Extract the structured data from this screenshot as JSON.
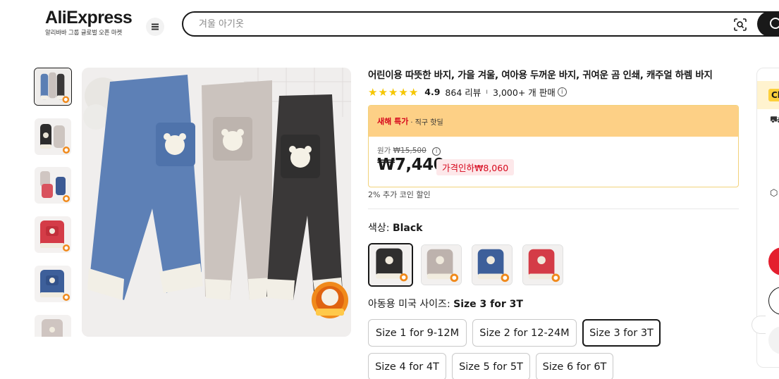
{
  "header": {
    "logo_text": "AliExpress",
    "logo_tagline": "알리바바 그룹 글로벌 오픈 마켓",
    "menu_icon": "hamburger-menu-icon",
    "search": {
      "placeholder": "겨울 아기옷",
      "value": ""
    },
    "camera_icon": "camera-search-icon",
    "search_icon": "search-icon"
  },
  "gallery": {
    "thumbnail_count": 6,
    "active_index": 0,
    "badge_icon": "flame-badge-icon"
  },
  "product": {
    "title": "어린이용 따뜻한 바지, 가을 겨울, 여아용 두꺼운 바지, 귀여운 곰 인쇄, 캐주얼 하렘 바지",
    "rating": "4.9",
    "reviews": "864 리뷰",
    "separator": "ı",
    "sold": "3,000+ 개 판매",
    "stars": 5
  },
  "deal": {
    "hot_label": "새해 특가",
    "hot_sub": "· 직구 핫딜",
    "original_label": "원가",
    "original_price": "₩15,500",
    "price": "₩7,440",
    "discount": "가격인하₩8,060",
    "coins": "2% 추가 코인 할인"
  },
  "color": {
    "label": "색상: ",
    "selected": "Black",
    "options": [
      "Black",
      "Gray",
      "Blue",
      "Red"
    ],
    "active_index": 0
  },
  "size": {
    "label": "아동용 미국 사이즈: ",
    "selected": "Size 3 for 3T",
    "options": [
      "Size 1 for 9-12M",
      "Size 2 for 12-24M",
      "Size 3 for 3T",
      "Size 4 for 4T",
      "Size 5 for 5T",
      "Size 6 for 6T"
    ],
    "active_index": 2
  },
  "right_panel": {
    "tag_text": "Ch",
    "truck_icon": "delivery-truck-icon",
    "box_icon": "package-icon"
  }
}
